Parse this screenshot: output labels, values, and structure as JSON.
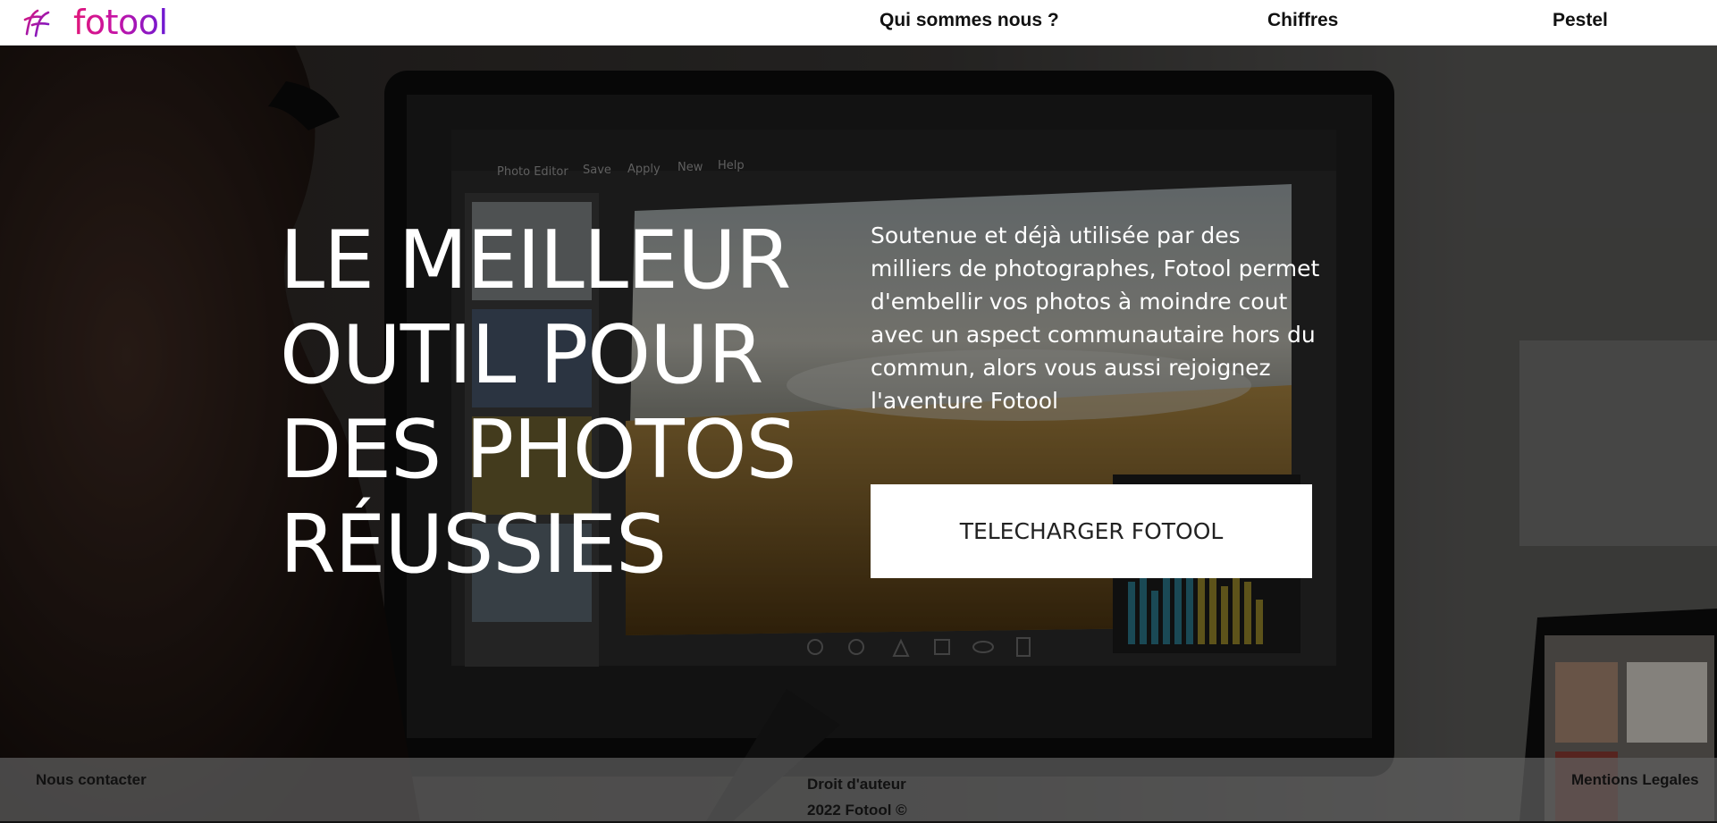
{
  "brand": {
    "name": "fotool",
    "logo_icon": "fotool-f-logo-icon",
    "colors": [
      "#e0177a",
      "#6a1ad4"
    ]
  },
  "nav": {
    "items": [
      "Qui sommes nous ?",
      "Chiffres",
      "Pestel"
    ]
  },
  "hero": {
    "headline_lines": [
      "LE MEILLEUR",
      "OUTIL POUR",
      "DES PHOTOS",
      "RÉUSSIES"
    ],
    "description": "Soutenue et déjà utilisée par des milliers de photographes, Fotool permet d'embellir vos photos à moindre cout avec un aspect communautaire hors du commun, alors vous aussi rejoignez l'aventure Fotool",
    "cta_label": "TELECHARGER FOTOOL",
    "editor_menu": [
      "Photo Editor",
      "Save",
      "Apply",
      "New",
      "Help"
    ]
  },
  "footer": {
    "contact": "Nous contacter",
    "copyright_title": "Droit d'auteur",
    "copyright_line": "2022 Fotool ©",
    "legal": "Mentions Legales"
  }
}
